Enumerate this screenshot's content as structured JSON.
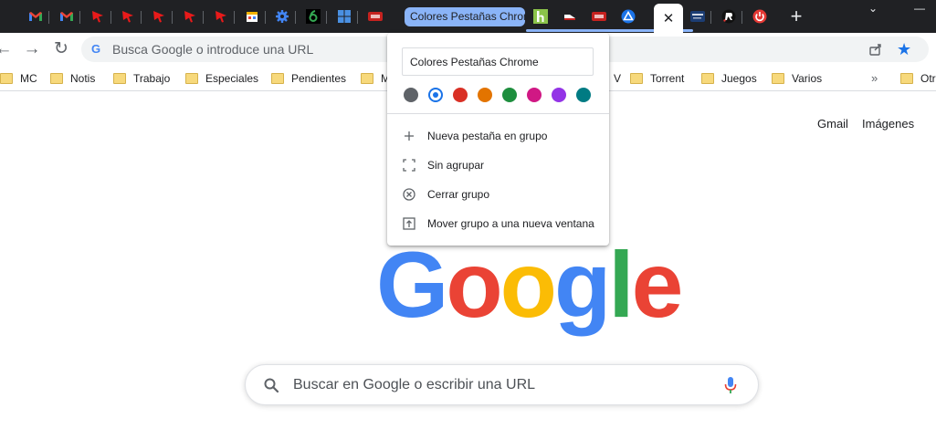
{
  "tabstrip": {
    "pinned_tabs": [
      {
        "icon": "gmail-icon",
        "color": "#ea4335"
      },
      {
        "icon": "gmail-icon",
        "color": "#ea4335"
      },
      {
        "icon": "red-arrow-icon",
        "color": "#e81a1a"
      },
      {
        "icon": "red-arrow-icon",
        "color": "#e81a1a"
      },
      {
        "icon": "red-arrow-icon",
        "color": "#e81a1a"
      },
      {
        "icon": "red-arrow-icon",
        "color": "#e81a1a"
      },
      {
        "icon": "red-arrow-icon",
        "color": "#e81a1a"
      },
      {
        "icon": "store-icon",
        "color": "#f4b400"
      },
      {
        "icon": "gear-icon",
        "color": "#4285f4"
      },
      {
        "icon": "six-icon",
        "color": "#34a853"
      },
      {
        "icon": "windows-icon",
        "color": "#4a90e2"
      },
      {
        "icon": "hub-icon",
        "color": "#c5221f"
      }
    ],
    "group_title": "Colores Pestañas Chrome",
    "group_color": "#8ab4f8",
    "group_tabs": [
      {
        "icon": "h-icon",
        "color": "#8bc34a"
      },
      {
        "icon": "shoe-icon",
        "color": "#c5221f"
      },
      {
        "icon": "hub-icon",
        "color": "#c5221f"
      },
      {
        "icon": "triangle-icon",
        "color": "#1a73e8"
      }
    ],
    "active_tab_close": "✕",
    "after_tabs": [
      {
        "icon": "review-icon",
        "color": "#1c3d73"
      },
      {
        "icon": "r-icon",
        "color": "#e53935"
      },
      {
        "icon": "power-icon",
        "color": "#e53935"
      }
    ],
    "new_tab": "+",
    "chevron": "⌄",
    "minimize": "—"
  },
  "toolbar": {
    "back": "←",
    "forward": "→",
    "reload": "↻",
    "omnibox_placeholder": "Busca Google o introduce una URL",
    "google_g": "G",
    "star": "★"
  },
  "bookmarks": [
    {
      "label": "MC"
    },
    {
      "label": "Notis"
    },
    {
      "label": "Trabajo"
    },
    {
      "label": "Especiales"
    },
    {
      "label": "Pendientes"
    },
    {
      "label": "M"
    },
    {
      "label": "V"
    },
    {
      "label": "Torrent"
    },
    {
      "label": "Juegos"
    },
    {
      "label": "Varios"
    },
    {
      "label": "Otr"
    }
  ],
  "bookmarks_more": "»",
  "page": {
    "gmail_link": "Gmail",
    "images_link": "Imágenes",
    "logo_letters": [
      "G",
      "o",
      "o",
      "g",
      "l",
      "e"
    ],
    "logo_colors": [
      "#4285f4",
      "#ea4335",
      "#fbbc05",
      "#4285f4",
      "#34a853",
      "#ea4335"
    ],
    "search_placeholder": "Buscar en Google o escribir una URL"
  },
  "popup": {
    "group_name": "Colores Pestañas Chrome",
    "colors": [
      {
        "name": "grey",
        "hex": "#5f6368",
        "selected": false
      },
      {
        "name": "blue",
        "hex": "#1a73e8",
        "selected": true
      },
      {
        "name": "red",
        "hex": "#d93025",
        "selected": false
      },
      {
        "name": "yellow",
        "hex": "#e37400",
        "selected": false
      },
      {
        "name": "green",
        "hex": "#1e8e3e",
        "selected": false
      },
      {
        "name": "pink",
        "hex": "#d01884",
        "selected": false
      },
      {
        "name": "purple",
        "hex": "#9334e6",
        "selected": false
      },
      {
        "name": "cyan",
        "hex": "#007b83",
        "selected": false
      }
    ],
    "menu": [
      {
        "label": "Nueva pestaña en grupo",
        "icon": "plus-icon"
      },
      {
        "label": "Sin agrupar",
        "icon": "ungroup-icon"
      },
      {
        "label": "Cerrar grupo",
        "icon": "close-circle-icon"
      },
      {
        "label": "Mover grupo a una nueva ventana",
        "icon": "move-window-icon"
      }
    ]
  }
}
